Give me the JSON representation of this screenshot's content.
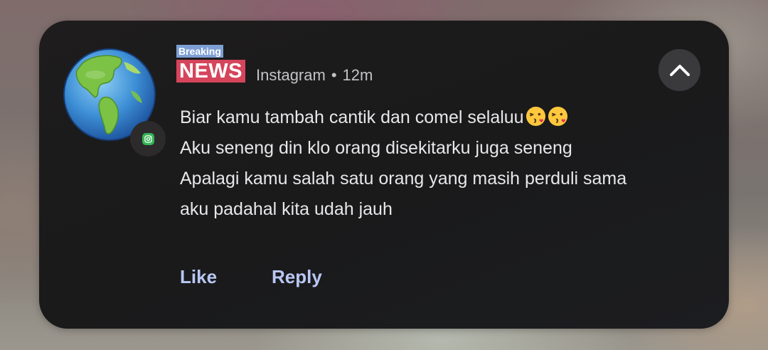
{
  "notification": {
    "brand": {
      "top_label": "Breaking",
      "main_label": "NEWS"
    },
    "app_name": "Instagram",
    "separator": "•",
    "time_ago": "12m",
    "message_lines": [
      "Biar kamu tambah cantik dan comel selaluu",
      "Aku seneng din klo orang disekitarku juga seneng",
      "Apalagi kamu salah satu orang yang masih perduli sama",
      "aku padahal kita udah jauh"
    ],
    "line1_emojis": [
      "kissing-face-emoji",
      "kissing-face-emoji"
    ],
    "avatar_icon": "globe-americas-icon",
    "app_badge_icon": "instagram-badge-icon",
    "collapse_icon": "chevron-up-icon",
    "actions": {
      "like_label": "Like",
      "reply_label": "Reply"
    }
  },
  "colors": {
    "card_background": "#1c1b1c",
    "primary_text": "#e7e7ea",
    "secondary_text": "#c3c3c6",
    "action_text": "#b9c7f3",
    "brand_top_bg": "#7e9fd4",
    "brand_main_bg": "#d5455b",
    "badge_green": "#34b457"
  }
}
